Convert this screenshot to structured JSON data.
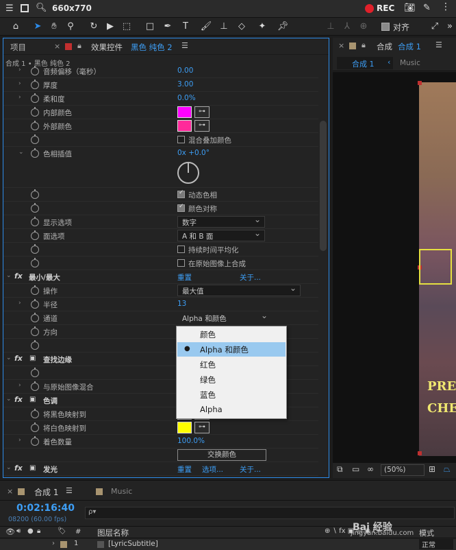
{
  "rec_bar": {
    "title": "660x770",
    "rec_label": "REC"
  },
  "toolbar": {
    "align_label": "对齐"
  },
  "effects_panel": {
    "tab_project": "项目",
    "tab_effects_prefix": "效果控件",
    "tab_effects_layer": "黑色 纯色 2",
    "breadcrumb": "合成 1 • 黑色 纯色 2",
    "rows": {
      "audio_offset": {
        "label": "音频偏移（毫秒）",
        "value": "0.00"
      },
      "thickness": {
        "label": "厚度",
        "value": "3.00"
      },
      "softness": {
        "label": "柔和度",
        "value": "0.0%"
      },
      "inner_color": {
        "label": "内部颜色",
        "swatch": "#ff00ff"
      },
      "outer_color": {
        "label": "外部颜色",
        "swatch": "#ff2a9a"
      },
      "blend_overlay": {
        "checkbox_label": "混合叠加颜色"
      },
      "hue_interp": {
        "label": "色相插值",
        "value": "0x +0.0°"
      },
      "dynamic_hue": {
        "checkbox_label": "动态色相"
      },
      "color_sym": {
        "checkbox_label": "颜色对称"
      },
      "display_options": {
        "label": "显示选项",
        "select": "数字"
      },
      "face_options": {
        "label": "面选项",
        "select": "A 和 B 面"
      },
      "time_avg": {
        "checkbox_label": "持续时间平均化"
      },
      "composite_orig": {
        "checkbox_label": "在原始图像上合成"
      },
      "minmax": {
        "label": "最小/最大",
        "reset": "重置",
        "about": "关于..."
      },
      "operation": {
        "label": "操作",
        "select": "最大值"
      },
      "radius": {
        "label": "半径",
        "value": "13"
      },
      "channel": {
        "label": "通道",
        "select": "Alpha 和颜色"
      },
      "direction": {
        "label": "方向"
      },
      "find_edges": {
        "label": "查找边缘"
      },
      "blend_orig": {
        "label": "与原始图像混合"
      },
      "tint": {
        "label": "色调"
      },
      "map_black": {
        "label": "将黑色映射到",
        "swatch": "#000000"
      },
      "map_white": {
        "label": "将白色映射到",
        "swatch": "#ffff00"
      },
      "tint_amount": {
        "label": "着色数量",
        "value": "100.0%"
      },
      "swap_colors": {
        "button": "交换颜色"
      },
      "glow": {
        "label": "发光",
        "reset": "重置",
        "options": "选项...",
        "about": "关于..."
      }
    },
    "fx_label": "fx",
    "channel_dropdown": {
      "options": [
        "颜色",
        "Alpha 和颜色",
        "红色",
        "绿色",
        "蓝色",
        "Alpha"
      ],
      "selected_index": 1
    }
  },
  "viewer": {
    "tab_comp_prefix": "合成",
    "tab_comp_name": "合成 1",
    "nav_comp": "合成 1",
    "nav_music": "Music",
    "zoom": "(50%)",
    "overlay_text_1": "PRE",
    "overlay_text_2": "CHE"
  },
  "timeline": {
    "tab_comp": "合成 1",
    "tab_music": "Music",
    "timecode": "0:02:16:40",
    "frame_info": "08200 (60.00 fps)",
    "search_placeholder": "ρ▾",
    "col_layer_name": "图层名称",
    "col_mode": "模式",
    "layer_index": "1",
    "layer_name": "[LyricSubtitle]",
    "layer_mode": "正常",
    "watermark": "jingyan.baidu.com",
    "watermark_brand": "Bai 经验"
  }
}
